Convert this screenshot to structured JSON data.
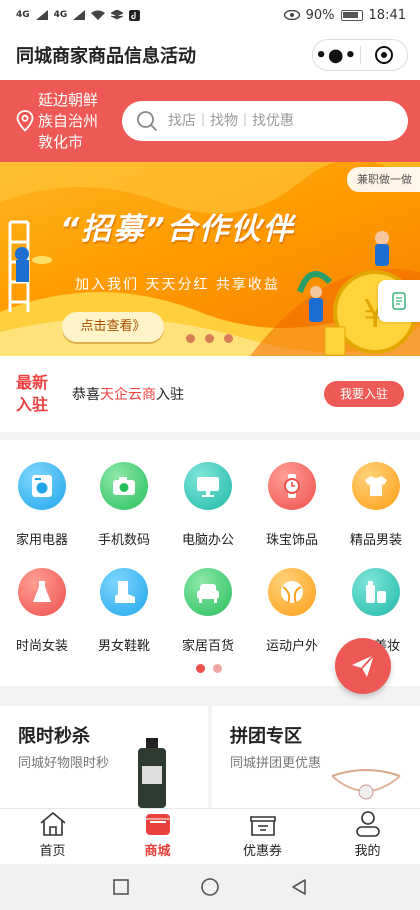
{
  "status_bar": {
    "network_left": "4G",
    "network_right": "4G",
    "battery": "90%",
    "time": "18:41"
  },
  "header": {
    "title": "同城商家商品信息活动",
    "more_icon": "more-dots-icon",
    "close_icon": "target-icon"
  },
  "location": {
    "text": "延边朝鲜族自治州敦化市",
    "icon": "location-pin-icon"
  },
  "search": {
    "placeholder": "找店｜找物｜找优惠",
    "icon": "search-icon"
  },
  "banner": {
    "tag": "兼职做一做",
    "title": "“招募”合作伙伴",
    "subtitle": "加入我们  天天分红  共享收益",
    "button": "点击查看》"
  },
  "news": {
    "tag": "最新入驻",
    "prefix": "恭喜",
    "highlight": "天企云商",
    "suffix": "入驻",
    "button": "我要入驻"
  },
  "categories": [
    {
      "label": "家用电器",
      "icon": "washing-machine-icon",
      "color": "#29b6f6"
    },
    {
      "label": "手机数码",
      "icon": "camera-icon",
      "color": "#2ecc71"
    },
    {
      "label": "电脑办公",
      "icon": "monitor-icon",
      "color": "#26c6b7"
    },
    {
      "label": "珠宝饰品",
      "icon": "watch-icon",
      "color": "#f25f5c"
    },
    {
      "label": "精品男装",
      "icon": "tshirt-icon",
      "color": "#ffa726"
    },
    {
      "label": "时尚女装",
      "icon": "dress-icon",
      "color": "#f25f5c"
    },
    {
      "label": "男女鞋靴",
      "icon": "boot-icon",
      "color": "#29b6f6"
    },
    {
      "label": "家居百货",
      "icon": "sofa-icon",
      "color": "#2ecc71"
    },
    {
      "label": "运动户外",
      "icon": "ball-icon",
      "color": "#ff9f43"
    },
    {
      "label": "美妆",
      "icon": "cosmetics-icon",
      "color": "#26c6b7"
    }
  ],
  "promos": {
    "flash": {
      "title": "限时秒杀",
      "subtitle": "同城好物限时秒"
    },
    "group": {
      "title": "拼团专区",
      "subtitle": "同城拼团更优惠"
    }
  },
  "tabs": [
    {
      "label": "首页",
      "icon": "home-icon"
    },
    {
      "label": "商城",
      "icon": "mall-icon"
    },
    {
      "label": "优惠券",
      "icon": "coupon-icon"
    },
    {
      "label": "我的",
      "icon": "user-icon"
    }
  ],
  "colors": {
    "accent": "#ee5855",
    "banner": "#ff9b00",
    "text_dark": "#222222"
  }
}
